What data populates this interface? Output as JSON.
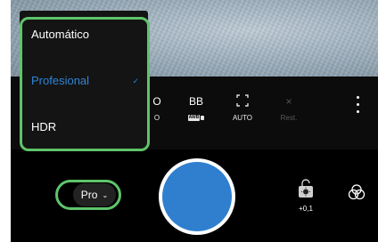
{
  "camera_settings": [
    {
      "id": "shutter",
      "top": "O",
      "bottom": "O",
      "enabled": true
    },
    {
      "id": "white-balance",
      "top": "BB",
      "badge": "AWB",
      "enabled": true
    },
    {
      "id": "focus",
      "bottom": "AUTO",
      "enabled": true
    },
    {
      "id": "reset",
      "top": "×",
      "bottom": "Rest.",
      "enabled": false
    }
  ],
  "mode_menu": {
    "items": [
      {
        "label": "Automático",
        "selected": false
      },
      {
        "label": "Profesional",
        "selected": true
      },
      {
        "label": "HDR",
        "selected": false
      }
    ],
    "checkmark": "✓"
  },
  "mode_selector": {
    "label": "Pro",
    "chevron": "⌄"
  },
  "exposure": {
    "value": "+0,1"
  },
  "colors": {
    "accent": "#2f84d6",
    "shutter_fill": "#2f7fce",
    "highlight": "#5ec46a",
    "background": "#000000"
  },
  "icons": {
    "more": "kebab-vertical-icon",
    "exposure": "exposure-lock-icon",
    "filters": "filters-icon",
    "focus": "focus-frame-icon"
  }
}
